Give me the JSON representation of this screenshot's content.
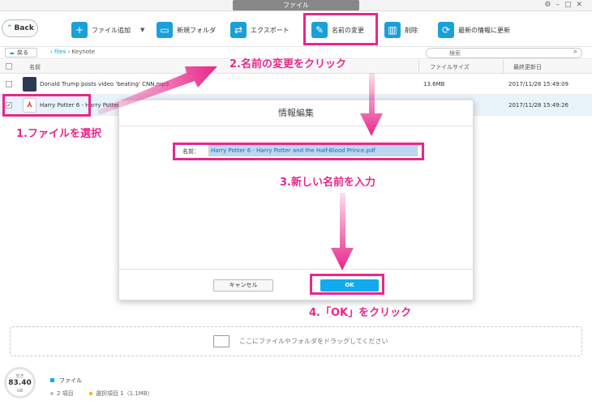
{
  "window": {
    "title": "ファイル"
  },
  "toolbar": {
    "back_label": "Back",
    "add_file": "ファイル追加",
    "new_folder": "新規フォルダ",
    "export": "エクスポート",
    "rename": "名前の変更",
    "delete": "削除",
    "refresh": "最新の情報に更新"
  },
  "path": {
    "return_label": "戻る",
    "root": "files",
    "current": "Keynote"
  },
  "search": {
    "placeholder": "検索"
  },
  "table": {
    "headers": {
      "name": "名前",
      "size": "ファイルサイズ",
      "date": "最終更新日"
    },
    "rows": [
      {
        "name": "Donald Trump posts video 'beating' CNN.mp3",
        "size": "13.6MB",
        "date": "2017/11/28 15:49:09",
        "selected": false
      },
      {
        "name": "Harry Potter 6 - Harry Potter",
        "size": "",
        "date": "2017/11/28 15:49:26",
        "selected": true
      }
    ]
  },
  "dialog": {
    "title": "情報編集",
    "field_label": "名前：",
    "field_value": "Harry Potter 6 - Harry Potter and the Half-Blood Prince.pdf",
    "cancel": "キャンセル",
    "ok": "OK"
  },
  "dropzone": {
    "text": "ここにファイルやフォルダをドラッグしてください"
  },
  "footer": {
    "gauge_top": "空き",
    "gauge_value": "83.40",
    "gauge_unit": "GB",
    "category": "ファイル",
    "count": "2 項目",
    "selected": "選択項目 1（1.1MB）"
  },
  "annotations": {
    "step1": "1.ファイルを選択",
    "step2": "2.名前の変更をクリック",
    "step3": "3.新しい名前を入力",
    "step4": "4.「OK」をクリック"
  },
  "colors": {
    "accent": "#1aa0d8",
    "annotation": "#e8278b",
    "ok_button": "#12aaee"
  }
}
